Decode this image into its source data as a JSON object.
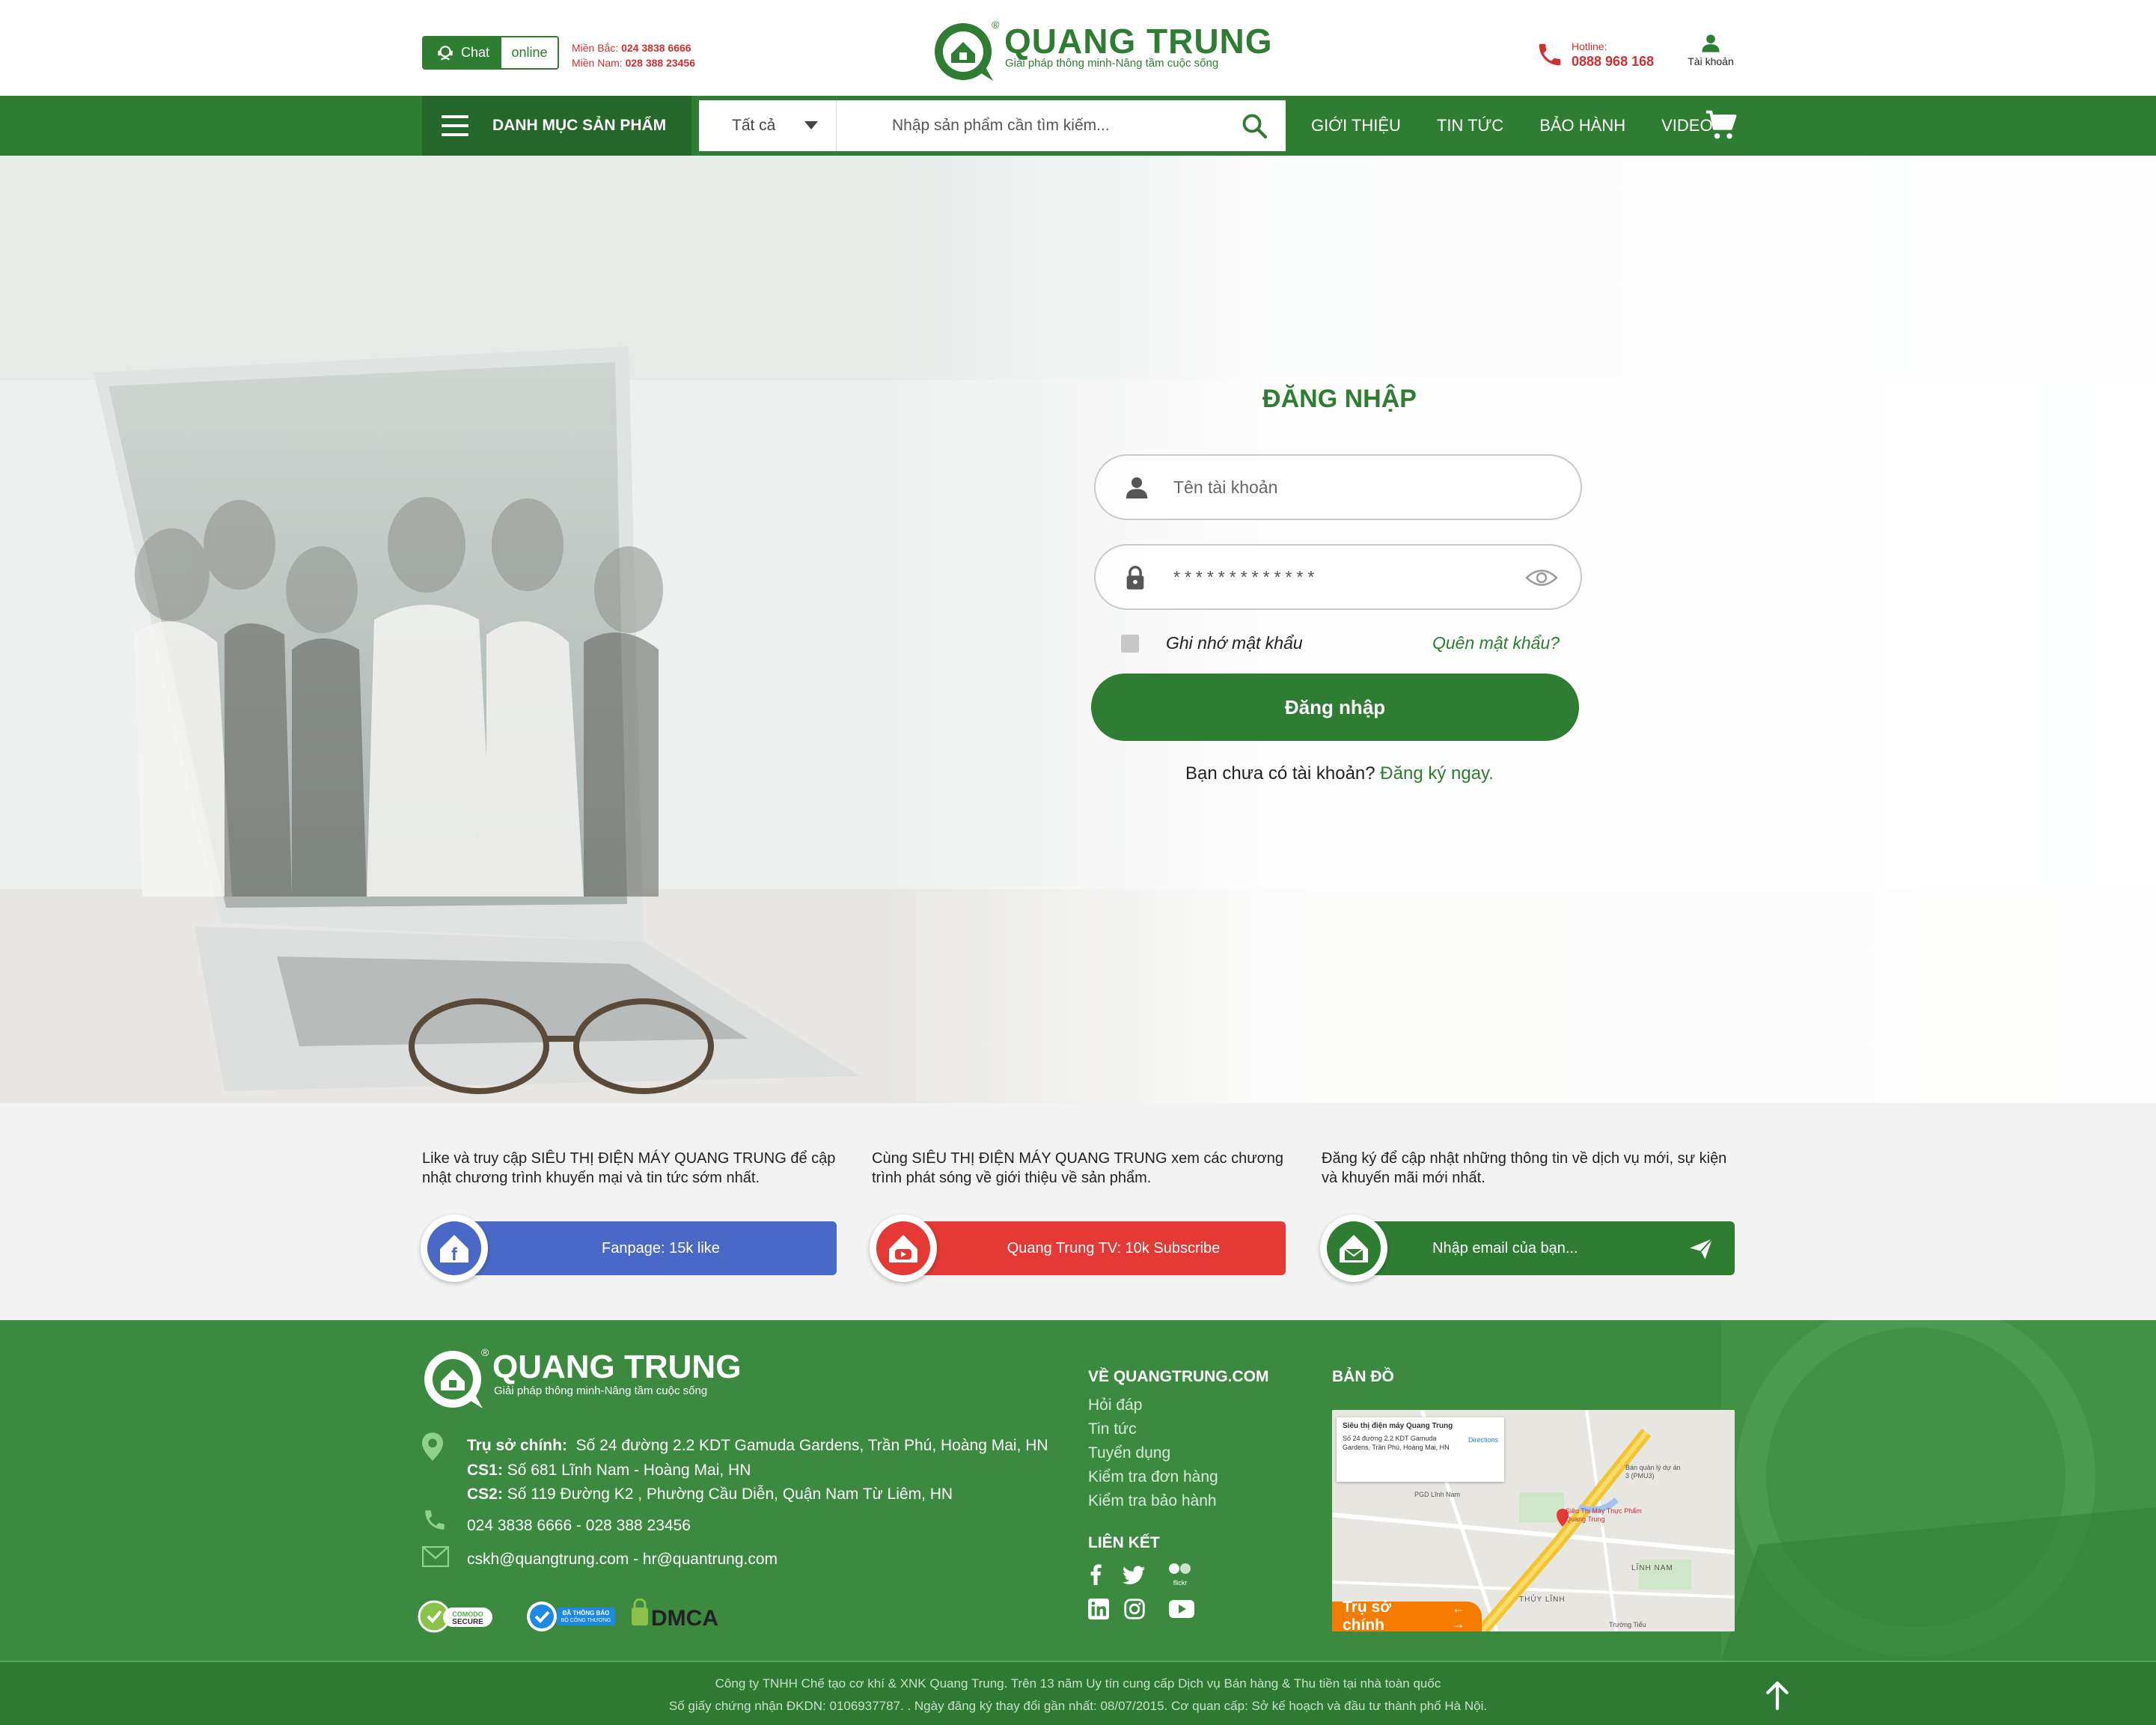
{
  "header": {
    "chat_label": "Chat",
    "online_label": "online",
    "hotline_north_label": "Miền Bắc:",
    "hotline_north_number": "024 3838 6666",
    "hotline_south_label": "Miền Nam:",
    "hotline_south_number": "028 388 23456",
    "logo_name": "QUANG TRUNG",
    "logo_slogan": "Giải pháp thông minh-Nâng tầm cuộc sống",
    "hotline_label": "Hotline:",
    "hotline_number": "0888 968 168",
    "account_label": "Tài khoản"
  },
  "nav": {
    "menu_label": "DANH MỤC SẢN PHẨM",
    "category_selected": "Tất cả",
    "search_placeholder": "Nhập sản phẩm cần tìm kiếm...",
    "links": [
      "GIỚI THIỆU",
      "TIN TỨC",
      "BẢO HÀNH",
      "VIDEO"
    ]
  },
  "login": {
    "title": "ĐĂNG NHẬP",
    "username_placeholder": "Tên tài khoản",
    "password_value": "*************",
    "remember_label": "Ghi nhớ mật khẩu",
    "forgot_label": "Quên mật khẩu?",
    "submit_label": "Đăng nhập",
    "no_account_text": "Bạn chưa có tài khoản?",
    "register_label": "Đăng ký ngay."
  },
  "social": {
    "facebook_text": "Like và truy cập SIÊU THỊ ĐIỆN MÁY QUANG TRUNG để cập nhật chương trình khuyến mại và tin tức sớm nhất.",
    "facebook_label": "Fanpage: 15k like",
    "youtube_text": "Cùng SIÊU THỊ ĐIỆN MÁY QUANG TRUNG xem các chương trình phát sóng về giới thiệu về sản phẩm.",
    "youtube_label": "Quang Trung TV: 10k Subscribe",
    "email_text": "Đăng ký để cập nhật những thông tin về dịch vụ mới, sự kiện và khuyến mãi mới nhất.",
    "email_placeholder": "Nhập email của bạn...",
    "colors": {
      "facebook": "#4a69c6",
      "youtube": "#e53935",
      "email": "#2e7d32"
    }
  },
  "footer": {
    "logo_name": "QUANG TRUNG",
    "logo_slogan": "Giải pháp thông minh-Nâng tầm cuộc sống",
    "hq_label": "Trụ sở chính:",
    "hq_address": "Số 24 đường 2.2 KDT Gamuda Gardens, Trần Phú, Hoàng Mai, HN",
    "cs1_label": "CS1:",
    "cs1_address": "Số 681 Lĩnh Nam - Hoàng Mai, HN",
    "cs2_label": "CS2:",
    "cs2_address": "Số 119 Đường K2 , Phường Cầu Diễn, Quận Nam Từ Liêm, HN",
    "phones": "024 3838 6666 - 028 388 23456",
    "emails": "cskh@quangtrung.com - hr@quantrung.com",
    "badges": [
      "COMODO SECURE",
      "ĐÃ THÔNG BÁO BỘ CÔNG THƯƠNG",
      "DMCA"
    ],
    "about_title": "VỀ QUANGTRUNG.COM",
    "about_links": [
      "Hỏi đáp",
      "Tin tức",
      "Tuyển dụng",
      "Kiểm tra đơn hàng",
      "Kiểm tra bảo hành"
    ],
    "links_title": "LIÊN KẾT",
    "social_icons": [
      "facebook-icon",
      "twitter-icon",
      "flickr-icon",
      "linkedin-icon",
      "instagram-icon",
      "youtube-icon"
    ],
    "map_title": "BẢN ĐỒ",
    "map_card_title": "Siêu thị điện máy Quang Trung",
    "map_card_address": "Số 24 đường 2.2 KDT Gamuda Gardens, Trần Phú, Hoàng Mai, HN",
    "map_directions": "Directions",
    "map_pin_label": "Siêu Thị Máy Thực Phẩm Quang Trung",
    "map_places": [
      "PGD Lĩnh Nam",
      "Bán quản lý dự án 3 (PMU3)",
      "LĨNH NAM",
      "THỦY LĨNH",
      "Trường Tiểu"
    ],
    "map_button": "Trụ sở chính"
  },
  "copyright": {
    "line1": "Công ty TNHH Chế tạo cơ khí & XNK Quang Trung. Trên 13 năm Uy tín cung cấp Dịch vụ Bán hàng & Thu tiền tại nhà toàn quốc",
    "line2": "Số giấy chứng nhận ĐKDN: 0106937787. . Ngày đăng ký thay đổi gần nhất: 08/07/2015. Cơ quan cấp: Sở kế hoạch và đầu tư thành phố Hà Nội."
  },
  "colors": {
    "brand_green": "#2e7d32",
    "hotline_red": "#d32f2f",
    "map_orange": "#f57c00"
  }
}
